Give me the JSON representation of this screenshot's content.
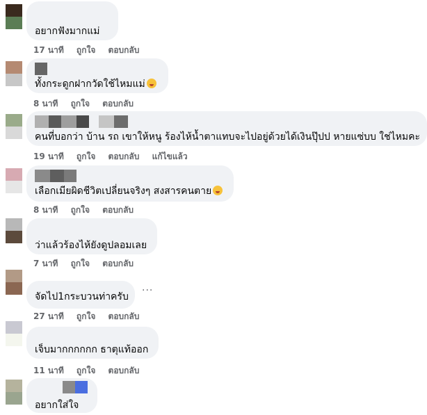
{
  "comments": [
    {
      "text": "อยากฟังมากแม่",
      "time": "17 นาที",
      "like": "ถูกใจ",
      "reply": "ตอบกลับ",
      "edited": ""
    },
    {
      "text": "ทั้งกระดูกฝากวัดใช้ไหมแม่",
      "time": "8 นาที",
      "like": "ถูกใจ",
      "reply": "ตอบกลับ",
      "edited": ""
    },
    {
      "text": "คนที่บอกว่า บ้าน รถ เขาให้หนู ร้องไห้น้ำตาแทบจะไปอยู่ด้วยได้เงินปุ๊ปป หายแซ่บบ ใช่ไหมคะ",
      "time": "19 นาที",
      "like": "ถูกใจ",
      "reply": "ตอบกลับ",
      "edited": "แก้ไขแล้ว"
    },
    {
      "text": "เลือกเมียผิดชีวิตเปลี่ยนจริงๆ สงสารคนตาย",
      "time": "8 นาที",
      "like": "ถูกใจ",
      "reply": "ตอบกลับ",
      "edited": ""
    },
    {
      "text": "ว่าแล้วร้องไห้ยังดูปลอมเลย",
      "time": "7 นาที",
      "like": "ถูกใจ",
      "reply": "ตอบกลับ",
      "edited": ""
    },
    {
      "text": "จัดไป1กระบวนท่าครับ",
      "time": "27 นาที",
      "like": "ถูกใจ",
      "reply": "ตอบกลับ",
      "edited": ""
    },
    {
      "text": "เจ็บมากกกกกก ธาตุแท้ออก",
      "time": "11 นาที",
      "like": "ถูกใจ",
      "reply": "ตอบกลับ",
      "edited": ""
    },
    {
      "text": "อยากใส่ใจ",
      "time": "",
      "like": "",
      "reply": "",
      "edited": ""
    }
  ],
  "more_options": "...",
  "icons": {
    "laughing": "laughing-emoji-icon",
    "pleading": "pleading-emoji-icon"
  },
  "colors": {
    "bubble": "#f0f2f5",
    "meta_text": "#65676b"
  }
}
